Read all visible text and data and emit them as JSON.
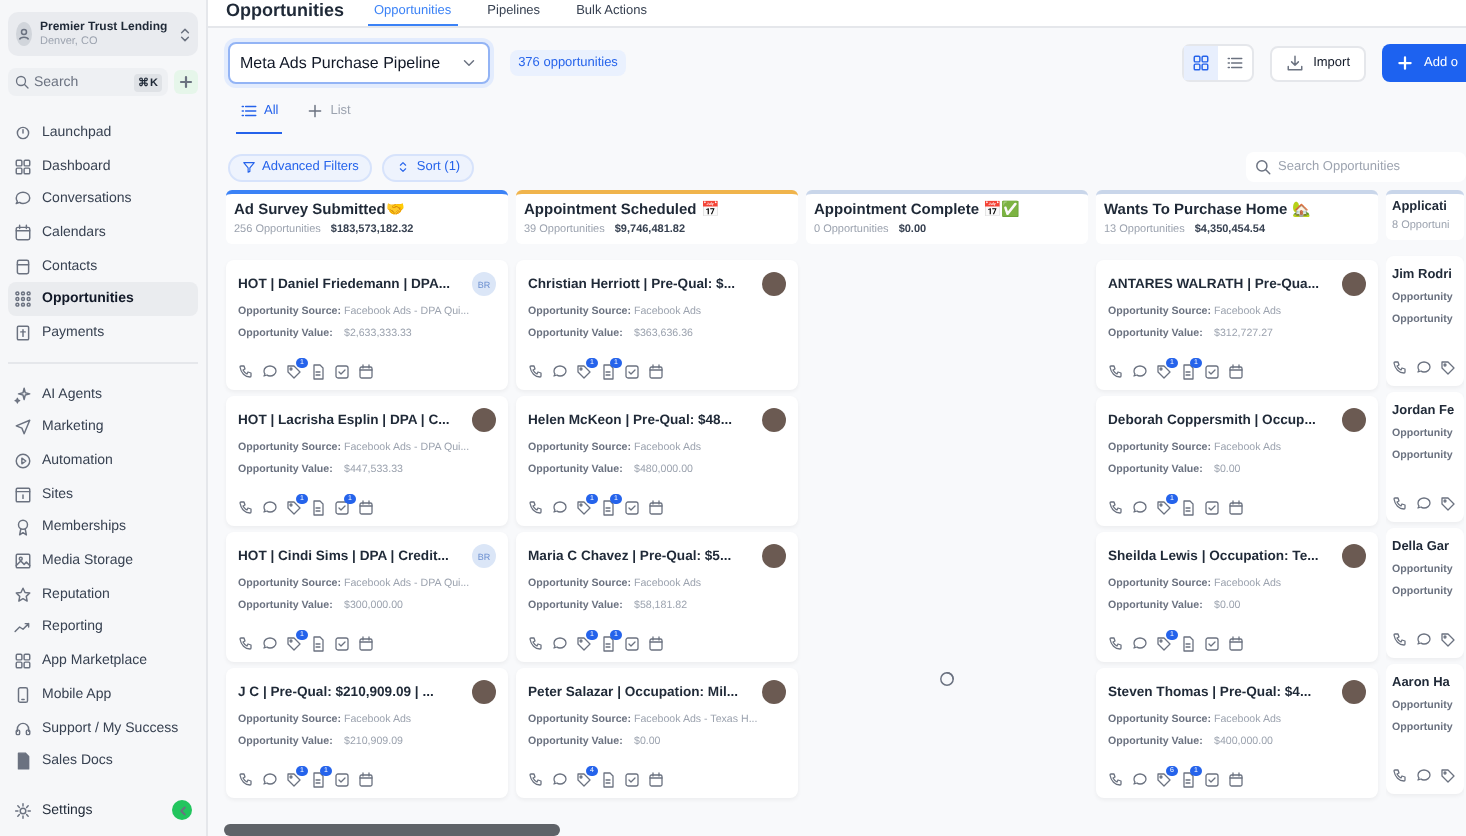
{
  "sidebar": {
    "account": {
      "name": "Premier Trust Lending",
      "location": "Denver, CO"
    },
    "search": {
      "placeholder": "Search",
      "shortcut": "⌘K"
    },
    "nav_groups": [
      [
        {
          "label": "Launchpad",
          "selected": false
        },
        {
          "label": "Dashboard",
          "selected": false
        },
        {
          "label": "Conversations",
          "selected": false
        },
        {
          "label": "Calendars",
          "selected": false
        },
        {
          "label": "Contacts",
          "selected": false
        },
        {
          "label": "Opportunities",
          "selected": true
        },
        {
          "label": "Payments",
          "selected": false
        }
      ],
      [
        {
          "label": "AI Agents",
          "selected": false
        },
        {
          "label": "Marketing",
          "selected": false
        },
        {
          "label": "Automation",
          "selected": false
        },
        {
          "label": "Sites",
          "selected": false
        },
        {
          "label": "Memberships",
          "selected": false
        },
        {
          "label": "Media Storage",
          "selected": false
        },
        {
          "label": "Reputation",
          "selected": false
        },
        {
          "label": "Reporting",
          "selected": false
        },
        {
          "label": "App Marketplace",
          "selected": false
        },
        {
          "label": "Mobile App",
          "selected": false
        },
        {
          "label": "Support / My Success",
          "selected": false
        },
        {
          "label": "Sales Docs",
          "selected": false
        }
      ]
    ],
    "footer_item": {
      "label": "Settings"
    }
  },
  "header": {
    "title": "Opportunities",
    "tabs": [
      {
        "label": "Opportunities",
        "selected": true
      },
      {
        "label": "Pipelines",
        "selected": false
      },
      {
        "label": "Bulk Actions",
        "selected": false
      }
    ]
  },
  "toolbar": {
    "pipeline": "Meta Ads Purchase Pipeline",
    "count": "376 opportunities",
    "view_toggle": [
      {
        "selected": true
      },
      {
        "selected": false
      }
    ],
    "import": "Import",
    "add": "Add o"
  },
  "views": [
    {
      "label": "All",
      "selected": true
    },
    {
      "label": "List",
      "selected": false
    }
  ],
  "filters": {
    "advanced": "Advanced Filters",
    "sort": "Sort (1)",
    "search_placeholder": "Search Opportunities"
  },
  "columns": [
    {
      "title": "Ad Survey Submitted🤝",
      "count": "256 Opportunities",
      "amount": "$183,573,182.32",
      "color": "#3b82f6",
      "cards": [
        {
          "title": "HOT | Daniel Friedemann | DPA...",
          "avatar": {
            "kind": "initials",
            "text": "BR"
          },
          "source_label": "Opportunity Source:",
          "source": "Facebook Ads - DPA Qui...",
          "value_label": "Opportunity Value:",
          "value": "$2,633,333.33",
          "actions": {
            "tags": "1"
          }
        },
        {
          "title": "HOT | Lacrisha Esplin | DPA | C...",
          "avatar": {
            "kind": "photo"
          },
          "source_label": "Opportunity Source:",
          "source": "Facebook Ads - DPA Qui...",
          "value_label": "Opportunity Value:",
          "value": "$447,533.33",
          "actions": {
            "tags": "1",
            "tasks": "1"
          }
        },
        {
          "title": "HOT | Cindi Sims | DPA | Credit...",
          "avatar": {
            "kind": "initials",
            "text": "BR"
          },
          "source_label": "Opportunity Source:",
          "source": "Facebook Ads - DPA Qui...",
          "value_label": "Opportunity Value:",
          "value": "$300,000.00",
          "actions": {
            "tags": "1"
          }
        },
        {
          "title": "J C | Pre-Qual: $210,909.09 | ...",
          "avatar": {
            "kind": "photo"
          },
          "source_label": "Opportunity Source:",
          "source": "Facebook Ads",
          "value_label": "Opportunity Value:",
          "value": "$210,909.09",
          "actions": {
            "tags": "1",
            "notes": "1"
          }
        }
      ]
    },
    {
      "title": "Appointment Scheduled 📅",
      "count": "39 Opportunities",
      "amount": "$9,746,481.82",
      "color": "#f0b44c",
      "cards": [
        {
          "title": "Christian Herriott | Pre-Qual: $...",
          "avatar": {
            "kind": "photo"
          },
          "source_label": "Opportunity Source:",
          "source": "Facebook Ads",
          "value_label": "Opportunity Value:",
          "value": "$363,636.36",
          "actions": {
            "tags": "1",
            "notes": "1"
          }
        },
        {
          "title": "Helen McKeon | Pre-Qual: $48...",
          "avatar": {
            "kind": "photo"
          },
          "source_label": "Opportunity Source:",
          "source": "Facebook Ads",
          "value_label": "Opportunity Value:",
          "value": "$480,000.00",
          "actions": {
            "tags": "1",
            "notes": "1"
          }
        },
        {
          "title": "Maria C Chavez | Pre-Qual: $5...",
          "avatar": {
            "kind": "photo"
          },
          "source_label": "Opportunity Source:",
          "source": "Facebook Ads",
          "value_label": "Opportunity Value:",
          "value": "$58,181.82",
          "actions": {
            "tags": "1",
            "notes": "1"
          }
        },
        {
          "title": "Peter Salazar | Occupation: Mil...",
          "avatar": {
            "kind": "photo"
          },
          "source_label": "Opportunity Source:",
          "source": "Facebook Ads - Texas H...",
          "value_label": "Opportunity Value:",
          "value": "$0.00",
          "actions": {
            "tags": "4"
          }
        }
      ]
    },
    {
      "title": "Appointment Complete 📅✅",
      "count": "0 Opportunities",
      "amount": "$0.00",
      "color": "#c9d6ea",
      "loading": true
    },
    {
      "title": "Wants To Purchase Home 🏡",
      "count": "13 Opportunities",
      "amount": "$4,350,454.54",
      "color": "#c9d6ea",
      "cards": [
        {
          "title": "ANTARES WALRATH | Pre-Qua...",
          "avatar": {
            "kind": "photo"
          },
          "source_label": "Opportunity Source:",
          "source": "Facebook Ads",
          "value_label": "Opportunity Value:",
          "value": "$312,727.27",
          "actions": {
            "tags": "1",
            "notes": "1"
          }
        },
        {
          "title": "Deborah Coppersmith | Occup...",
          "avatar": {
            "kind": "photo"
          },
          "source_label": "Opportunity Source:",
          "source": "Facebook Ads",
          "value_label": "Opportunity Value:",
          "value": "$0.00",
          "actions": {
            "tags": "1"
          }
        },
        {
          "title": "Sheilda Lewis | Occupation: Te...",
          "avatar": {
            "kind": "photo"
          },
          "source_label": "Opportunity Source:",
          "source": "Facebook Ads",
          "value_label": "Opportunity Value:",
          "value": "$0.00",
          "actions": {
            "tags": "1"
          }
        },
        {
          "title": "Steven Thomas | Pre-Qual: $4...",
          "avatar": {
            "kind": "photo"
          },
          "source_label": "Opportunity Source:",
          "source": "Facebook Ads",
          "value_label": "Opportunity Value:",
          "value": "$400,000.00",
          "actions": {
            "tags": "6",
            "notes": "1"
          }
        }
      ]
    },
    {
      "title": "Applicati",
      "count": "8 Opportuni",
      "color": "#c9d6ea",
      "cards": [
        {
          "title": "Jim Rodri",
          "source_label": "Opportunity",
          "value_label": "Opportunity"
        },
        {
          "title": "Jordan Fe",
          "source_label": "Opportunity",
          "value_label": "Opportunity"
        },
        {
          "title": "Della Gar",
          "source_label": "Opportunity",
          "value_label": "Opportunity"
        },
        {
          "title": "Aaron Ha",
          "source_label": "Opportunity",
          "value_label": "Opportunity"
        }
      ]
    }
  ]
}
